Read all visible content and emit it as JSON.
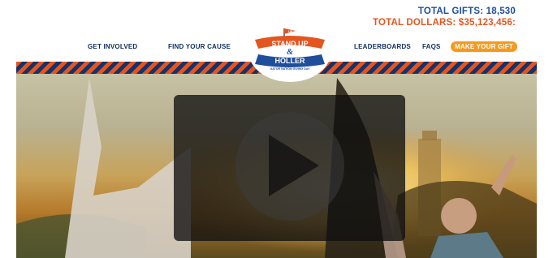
{
  "totals": {
    "gifts": "TOTAL GIFTS: 18,530",
    "dollars": "TOTAL DOLLARS: $35,123,456:"
  },
  "nav": {
    "get_involved": "GET INVOLVED",
    "find_your_cause": "FIND YOUR CAUSE",
    "leaderboards": "LEADERBOARDS",
    "faqs": "FAQS",
    "make_your_gift": "MAKE YOUR GIFT"
  },
  "logo": {
    "name": "Stand Up & Holler logo",
    "line1": "STAND UP",
    "ampersand": "&",
    "line2": "HOLLER",
    "tagline": "GATOR NATION GIVING DAY",
    "flag": "UF"
  },
  "colors": {
    "brand_blue": "#1f4e9c",
    "brand_orange": "#e4551f",
    "navy": "#0d2d5e",
    "button_orange": "#f59a1e"
  },
  "video": {
    "icon": "play-icon"
  }
}
